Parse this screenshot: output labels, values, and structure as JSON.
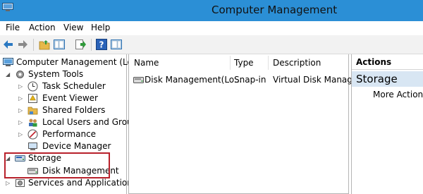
{
  "window": {
    "title": "Computer Management"
  },
  "menu": [
    "File",
    "Action",
    "View",
    "Help"
  ],
  "toolbar": {
    "buttons": [
      "back-icon",
      "forward-icon",
      "up-folder-icon",
      "show-hide-tree-icon",
      "export-list-icon",
      "help-icon",
      "show-hide-action-pane-icon"
    ]
  },
  "tree": {
    "root": "Computer Management (Local",
    "system_tools": "System Tools",
    "task_scheduler": "Task Scheduler",
    "event_viewer": "Event Viewer",
    "shared_folders": "Shared Folders",
    "local_users_groups": "Local Users and Groups",
    "performance": "Performance",
    "device_manager": "Device Manager",
    "storage": "Storage",
    "disk_management": "Disk Management",
    "services_apps": "Services and Applications"
  },
  "list": {
    "columns": {
      "name": "Name",
      "type": "Type",
      "description": "Description"
    },
    "rows": [
      {
        "name": "Disk Management(Lo...",
        "type": "Snap-in",
        "description": "Virtual Disk Manager"
      }
    ]
  },
  "actions": {
    "header": "Actions",
    "section": "Storage",
    "items": [
      "More Actions"
    ]
  },
  "colors": {
    "titlebar": "#2b8fd6",
    "highlight_border": "#b8212b",
    "selected_section": "#d8e6f3"
  }
}
